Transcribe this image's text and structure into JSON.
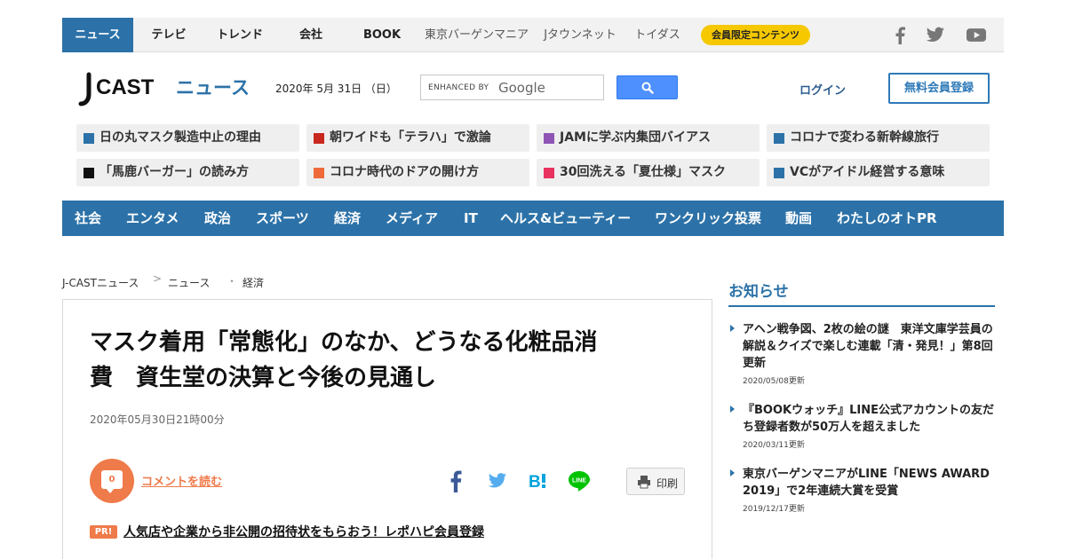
{
  "top_nav": {
    "items": [
      "ニュース",
      "テレビ",
      "トレンド",
      "会社",
      "BOOK",
      "東京バーゲンマニア",
      "Jタウンネット",
      "トイダス"
    ],
    "member_label": "会員限定コンテンツ",
    "active_color": "#2c72a8"
  },
  "header": {
    "logo_text_j": "J",
    "logo_text_cast": "CAST",
    "logo_text_news": "ニュース",
    "date": "2020年 5月 31日 （日）",
    "search_enhanced": "ENHANCED BY",
    "search_google": "Google",
    "login_label": "ログイン",
    "register_label": "無料会員登録"
  },
  "topics": [
    {
      "label": "日の丸マスク製造中止の理由",
      "color": "#2c72a8"
    },
    {
      "label": "朝ワイドも「テラハ」で激論",
      "color": "#c8281e"
    },
    {
      "label": "JAMに学ぶ内集団バイアス",
      "color": "#8e55b5"
    },
    {
      "label": "コロナで変わる新幹線旅行",
      "color": "#2c72a8"
    },
    {
      "label": "「馬鹿バーガー」の読み方",
      "color": "#111111"
    },
    {
      "label": "コロナ時代のドアの開け方",
      "color": "#ef6a3a"
    },
    {
      "label": "30回洗える「夏仕様」マスク",
      "color": "#e8335f"
    },
    {
      "label": "VCがアイドル経営する意味",
      "color": "#2c72a8"
    }
  ],
  "categories": [
    "社会",
    "エンタメ",
    "政治",
    "スポーツ",
    "経済",
    "メディア",
    "IT",
    "ヘルス&ビューティー",
    "ワンクリック投票",
    "動画",
    "わたしのオトPR"
  ],
  "breadcrumb": [
    "J-CASTニュース",
    "ニュース",
    "経済"
  ],
  "article": {
    "title_line1": "マスク着用「常態化」のなか、どうなる化粧品消",
    "title_line2": "費　資生堂の決算と今後の見通し",
    "date": "2020年05月30日21時00分",
    "comment_count": "0",
    "comment_label": "コメントを読む",
    "print_label": "印刷",
    "pr_badge": "PR!",
    "pr_text": "人気店や企業から非公開の招待状をもらおう！レポハピ会員登録"
  },
  "sidebar": {
    "title": "お知らせ",
    "notices": [
      {
        "title": "アヘン戦争図、2枚の絵の謎　東洋文庫学芸員の解説＆クイズで楽しむ連載「清・発見！」第8回更新",
        "date": "2020/05/08更新"
      },
      {
        "title": "『BOOKウォッチ』LINE公式アカウントの友だち登録者数が50万人を超えました",
        "date": "2020/03/11更新"
      },
      {
        "title": "東京バーゲンマニアがLINE「NEWS AWARD 2019」で2年連続大賞を受賞",
        "date": "2019/12/17更新"
      }
    ]
  }
}
